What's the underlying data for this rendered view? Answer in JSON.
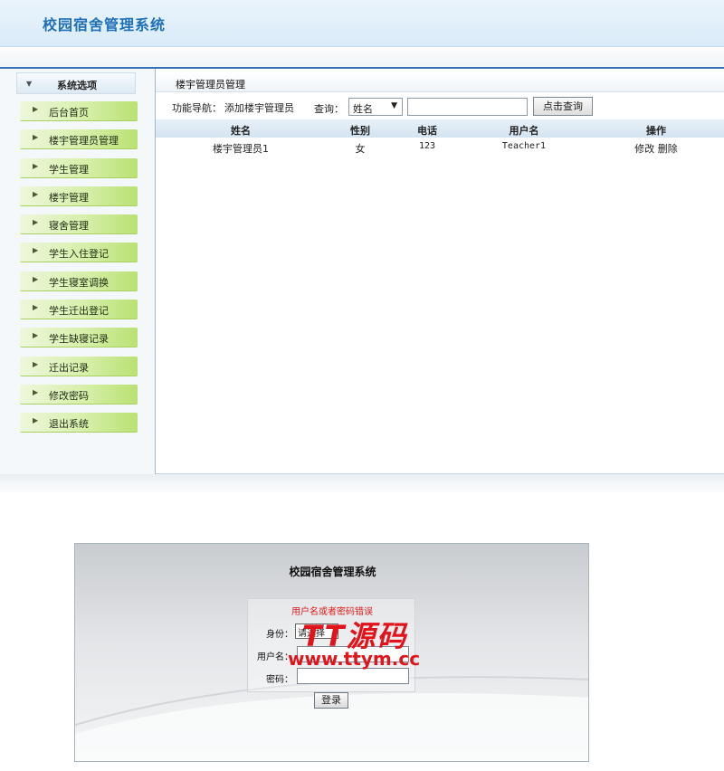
{
  "header": {
    "title": "校园宿舍管理系统"
  },
  "sidebar": {
    "heading": "系统选项",
    "items": [
      {
        "label": "后台首页"
      },
      {
        "label": "楼宇管理员管理"
      },
      {
        "label": "学生管理"
      },
      {
        "label": "楼宇管理"
      },
      {
        "label": "寝舍管理"
      },
      {
        "label": "学生入住登记"
      },
      {
        "label": "学生寝室调换"
      },
      {
        "label": "学生迁出登记"
      },
      {
        "label": "学生缺寝记录"
      },
      {
        "label": "迁出记录"
      },
      {
        "label": "修改密码"
      },
      {
        "label": "退出系统"
      }
    ]
  },
  "main": {
    "title": "楼宇管理员管理",
    "nav_label": "功能导航：",
    "nav_link": "添加楼宇管理员",
    "query_label": "查询：",
    "query_field": "姓名",
    "query_button": "点击查询",
    "columns": [
      "姓名",
      "性别",
      "电话",
      "用户名",
      "操作"
    ],
    "rows": [
      {
        "name": "楼宇管理员1",
        "gender": "女",
        "phone": "123",
        "username": "Teacher1",
        "edit": "修改",
        "delete": "删除"
      }
    ]
  },
  "login": {
    "title": "校园宿舍管理系统",
    "error": "用户名或者密码错误",
    "role_label": "身份：",
    "role_value": "请选择",
    "user_label": "用户名：",
    "password_label": "密码：",
    "submit": "登录"
  },
  "watermark": {
    "text": "TT源码",
    "url": "www.ttym.cc"
  },
  "colors": {
    "accent": "#1e6fb8",
    "menu_green": "#b9e173",
    "error_red": "#e01818",
    "watermark_red": "#e2141b"
  }
}
